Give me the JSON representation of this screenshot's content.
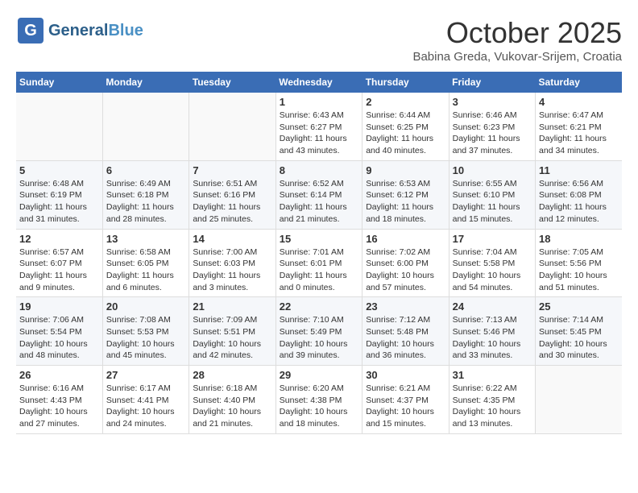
{
  "logo": {
    "general": "General",
    "blue": "Blue"
  },
  "title": "October 2025",
  "subtitle": "Babina Greda, Vukovar-Srijem, Croatia",
  "headers": [
    "Sunday",
    "Monday",
    "Tuesday",
    "Wednesday",
    "Thursday",
    "Friday",
    "Saturday"
  ],
  "weeks": [
    [
      {
        "day": "",
        "info": ""
      },
      {
        "day": "",
        "info": ""
      },
      {
        "day": "",
        "info": ""
      },
      {
        "day": "1",
        "info": "Sunrise: 6:43 AM\nSunset: 6:27 PM\nDaylight: 11 hours\nand 43 minutes."
      },
      {
        "day": "2",
        "info": "Sunrise: 6:44 AM\nSunset: 6:25 PM\nDaylight: 11 hours\nand 40 minutes."
      },
      {
        "day": "3",
        "info": "Sunrise: 6:46 AM\nSunset: 6:23 PM\nDaylight: 11 hours\nand 37 minutes."
      },
      {
        "day": "4",
        "info": "Sunrise: 6:47 AM\nSunset: 6:21 PM\nDaylight: 11 hours\nand 34 minutes."
      }
    ],
    [
      {
        "day": "5",
        "info": "Sunrise: 6:48 AM\nSunset: 6:19 PM\nDaylight: 11 hours\nand 31 minutes."
      },
      {
        "day": "6",
        "info": "Sunrise: 6:49 AM\nSunset: 6:18 PM\nDaylight: 11 hours\nand 28 minutes."
      },
      {
        "day": "7",
        "info": "Sunrise: 6:51 AM\nSunset: 6:16 PM\nDaylight: 11 hours\nand 25 minutes."
      },
      {
        "day": "8",
        "info": "Sunrise: 6:52 AM\nSunset: 6:14 PM\nDaylight: 11 hours\nand 21 minutes."
      },
      {
        "day": "9",
        "info": "Sunrise: 6:53 AM\nSunset: 6:12 PM\nDaylight: 11 hours\nand 18 minutes."
      },
      {
        "day": "10",
        "info": "Sunrise: 6:55 AM\nSunset: 6:10 PM\nDaylight: 11 hours\nand 15 minutes."
      },
      {
        "day": "11",
        "info": "Sunrise: 6:56 AM\nSunset: 6:08 PM\nDaylight: 11 hours\nand 12 minutes."
      }
    ],
    [
      {
        "day": "12",
        "info": "Sunrise: 6:57 AM\nSunset: 6:07 PM\nDaylight: 11 hours\nand 9 minutes."
      },
      {
        "day": "13",
        "info": "Sunrise: 6:58 AM\nSunset: 6:05 PM\nDaylight: 11 hours\nand 6 minutes."
      },
      {
        "day": "14",
        "info": "Sunrise: 7:00 AM\nSunset: 6:03 PM\nDaylight: 11 hours\nand 3 minutes."
      },
      {
        "day": "15",
        "info": "Sunrise: 7:01 AM\nSunset: 6:01 PM\nDaylight: 11 hours\nand 0 minutes."
      },
      {
        "day": "16",
        "info": "Sunrise: 7:02 AM\nSunset: 6:00 PM\nDaylight: 10 hours\nand 57 minutes."
      },
      {
        "day": "17",
        "info": "Sunrise: 7:04 AM\nSunset: 5:58 PM\nDaylight: 10 hours\nand 54 minutes."
      },
      {
        "day": "18",
        "info": "Sunrise: 7:05 AM\nSunset: 5:56 PM\nDaylight: 10 hours\nand 51 minutes."
      }
    ],
    [
      {
        "day": "19",
        "info": "Sunrise: 7:06 AM\nSunset: 5:54 PM\nDaylight: 10 hours\nand 48 minutes."
      },
      {
        "day": "20",
        "info": "Sunrise: 7:08 AM\nSunset: 5:53 PM\nDaylight: 10 hours\nand 45 minutes."
      },
      {
        "day": "21",
        "info": "Sunrise: 7:09 AM\nSunset: 5:51 PM\nDaylight: 10 hours\nand 42 minutes."
      },
      {
        "day": "22",
        "info": "Sunrise: 7:10 AM\nSunset: 5:49 PM\nDaylight: 10 hours\nand 39 minutes."
      },
      {
        "day": "23",
        "info": "Sunrise: 7:12 AM\nSunset: 5:48 PM\nDaylight: 10 hours\nand 36 minutes."
      },
      {
        "day": "24",
        "info": "Sunrise: 7:13 AM\nSunset: 5:46 PM\nDaylight: 10 hours\nand 33 minutes."
      },
      {
        "day": "25",
        "info": "Sunrise: 7:14 AM\nSunset: 5:45 PM\nDaylight: 10 hours\nand 30 minutes."
      }
    ],
    [
      {
        "day": "26",
        "info": "Sunrise: 6:16 AM\nSunset: 4:43 PM\nDaylight: 10 hours\nand 27 minutes."
      },
      {
        "day": "27",
        "info": "Sunrise: 6:17 AM\nSunset: 4:41 PM\nDaylight: 10 hours\nand 24 minutes."
      },
      {
        "day": "28",
        "info": "Sunrise: 6:18 AM\nSunset: 4:40 PM\nDaylight: 10 hours\nand 21 minutes."
      },
      {
        "day": "29",
        "info": "Sunrise: 6:20 AM\nSunset: 4:38 PM\nDaylight: 10 hours\nand 18 minutes."
      },
      {
        "day": "30",
        "info": "Sunrise: 6:21 AM\nSunset: 4:37 PM\nDaylight: 10 hours\nand 15 minutes."
      },
      {
        "day": "31",
        "info": "Sunrise: 6:22 AM\nSunset: 4:35 PM\nDaylight: 10 hours\nand 13 minutes."
      },
      {
        "day": "",
        "info": ""
      }
    ]
  ]
}
